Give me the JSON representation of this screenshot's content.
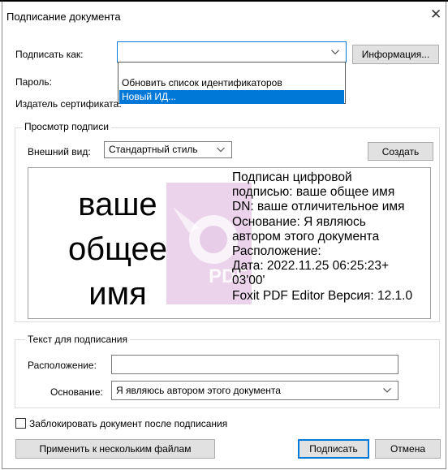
{
  "dialog": {
    "title": "Подписание документа",
    "close_glyph": "✕"
  },
  "sign_as": {
    "label": "Подписать как:",
    "value": "",
    "info_button": "Информация..."
  },
  "password": {
    "label": "Пароль:"
  },
  "issuer": {
    "label": "Издатель сертификата:"
  },
  "dropdown": {
    "items": [
      {
        "label": "Обновить список идентификаторов",
        "selected": false
      },
      {
        "label": "Новый ИД...",
        "selected": true
      }
    ]
  },
  "preview_group": {
    "legend": "Просмотр подписи",
    "appearance_label": "Внешний вид:",
    "appearance_value": "Стандартный стиль",
    "create_button": "Создать",
    "name_lines": [
      "ваше",
      "общее",
      "имя"
    ],
    "details": [
      "Подписан цифровой",
      "подписью: ваше общее имя",
      "DN: ваше отличительное имя",
      "Основание: Я являюсь",
      "автором этого документа",
      "Расположение:",
      "Дата: 2022.11.25 06:25:23+",
      "03'00'",
      "Foxit PDF Editor Версия: 12.1.0"
    ],
    "watermark_text": "PDF"
  },
  "text_group": {
    "legend": "Текст для подписания",
    "location_label": "Расположение:",
    "location_value": "",
    "reason_label": "Основание:",
    "reason_value": "Я являюсь автором этого документа"
  },
  "lock_checkbox": {
    "label": "Заблокировать документ после подписания",
    "checked": false
  },
  "footer": {
    "apply_multiple": "Применить к нескольким файлам",
    "sign": "Подписать",
    "cancel": "Отмена"
  },
  "colors": {
    "accent": "#0078d7",
    "watermark": "#d9b6d9"
  }
}
